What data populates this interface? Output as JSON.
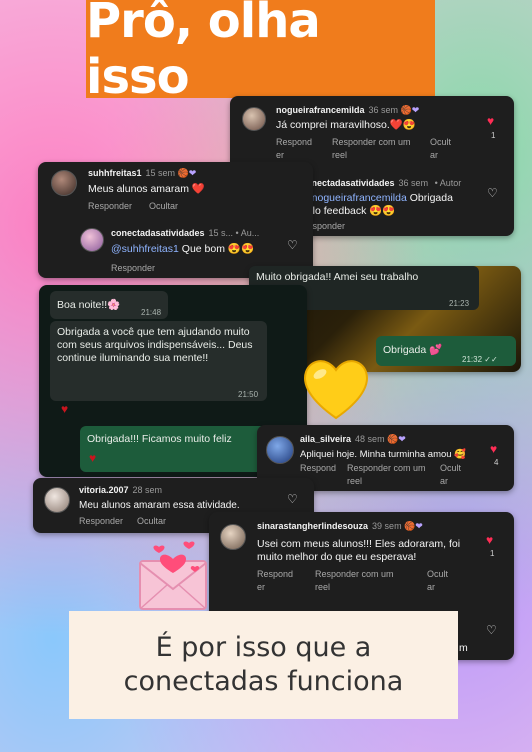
{
  "title": "Prô, olha isso",
  "footer": "É por isso que a conectadas funciona",
  "comments": {
    "c1": {
      "user": "nogueirafrancemilda",
      "time": "36 sem",
      "badge": "🏀❤",
      "text": "Já comprei maravilhoso.❤️😍",
      "reply": "Respond er",
      "reply_with": "Responder com um reel",
      "hide": "Ocult ar",
      "likes": "1"
    },
    "c1r": {
      "user": "conectadasatividades",
      "time": "36 sem",
      "author": "• Autor",
      "mention": "@nogueirafrancemilda",
      "text": " Obrigada pelo feedback 😍😍",
      "reply": "Responder"
    },
    "c2": {
      "user": "suhhfreitas1",
      "time": "15 sem",
      "badge": "🏀❤",
      "text": "Meus alunos amaram ❤️",
      "reply": "Responder",
      "hide": "Ocultar"
    },
    "c2r": {
      "user": "conectadasatividades",
      "time": "15 s... • Au...",
      "mention": "@suhhfreitas1",
      "text": " Que bom 😍😍",
      "reply": "Responder"
    },
    "c3": {
      "user": "aila_silveira",
      "time": "48 sem",
      "badge": "🏀❤",
      "text": "Apliquei hoje. Minha turminha amou 🥰",
      "reply": "Respond er",
      "reply_with": "Responder com um reel",
      "hide": "Ocult ar",
      "likes": "4"
    },
    "c4": {
      "user": "vitoria.2007",
      "time": "28 sem",
      "text": "Meu alunos amaram essa atividade.",
      "reply": "Responder",
      "hide": "Ocultar"
    },
    "c5": {
      "user": "sinarastangherlindesouza",
      "time": "39 sem",
      "badge": "🏀❤",
      "text": "Usei com meus alunos!!! Eles adoraram, foi muito melhor do que eu esperava!",
      "reply": "Respond er",
      "reply_with": "Responder com um reel",
      "hide": "Ocult ar",
      "likes": "1",
      "tail": "m"
    }
  },
  "whatsapp1": {
    "b1": "Boa noite!!🌸",
    "t1": "21:48",
    "b2": "Obrigada a você que tem ajudando muito com seus arquivos indispensáveis... Deus continue iluminando sua mente!!",
    "t2": "21:50",
    "b3": "Obrigada!!! Ficamos muito feliz",
    "t3": "2"
  },
  "whatsapp2": {
    "b1": "Muito obrigada!! Amei seu trabalho",
    "t1": "21:23",
    "b2": "Obrigada 💕",
    "t2": "21:32 ✓✓"
  },
  "colors": {
    "banner": "#f07c1c",
    "heart": "#ff2d55"
  }
}
